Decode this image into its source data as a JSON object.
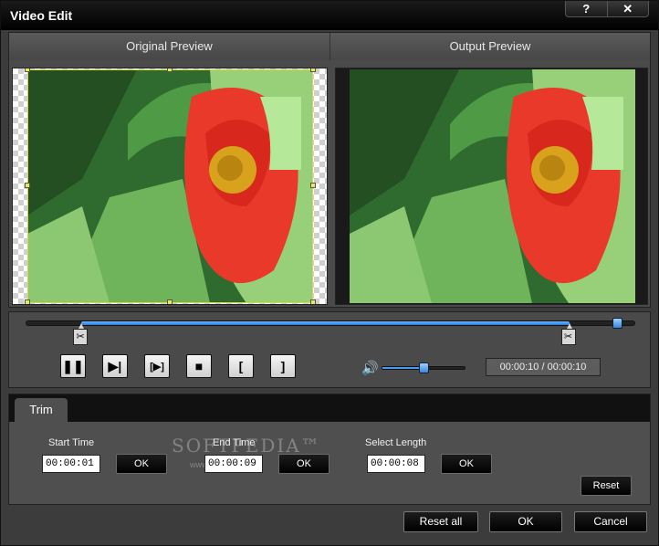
{
  "window": {
    "title": "Video Edit",
    "help_label": "?",
    "close_label": "✕"
  },
  "preview": {
    "original_label": "Original Preview",
    "output_label": "Output Preview"
  },
  "playback": {
    "trim_start_fraction": 0.09,
    "trim_end_fraction": 0.89,
    "playhead_fraction": 0.97,
    "volume_fraction": 0.5,
    "time_display": "00:00:10 / 00:00:10",
    "icons": [
      "pause-icon",
      "next-frame-icon",
      "play-segment-icon",
      "stop-icon",
      "mark-in-icon",
      "mark-out-icon",
      "volume-icon",
      "scissors-icon"
    ],
    "btn_pause": "❚❚",
    "btn_step": "▶|",
    "btn_play_segment": "[▶]",
    "btn_stop": "■",
    "btn_mark_in": "[",
    "btn_mark_out": "]",
    "volume_glyph": "🔊",
    "scissor_glyph": "✂"
  },
  "trim": {
    "tab_label": "Trim",
    "start_label": "Start Time",
    "start_value": "00:00:01",
    "end_label": "End Time",
    "end_value": "00:00:09",
    "length_label": "Select Length",
    "length_value": "00:00:08",
    "ok_label": "OK",
    "reset_label": "Reset",
    "watermark": "SOFTPEDIA™",
    "watermark_url": "www.softpedia.com"
  },
  "footer": {
    "reset_all_label": "Reset all",
    "ok_label": "OK",
    "cancel_label": "Cancel"
  },
  "colors": {
    "accent": "#3a85d8",
    "crop_border": "#d7d74a",
    "petal": "#e8392a",
    "leaf": "#5aa84a"
  }
}
